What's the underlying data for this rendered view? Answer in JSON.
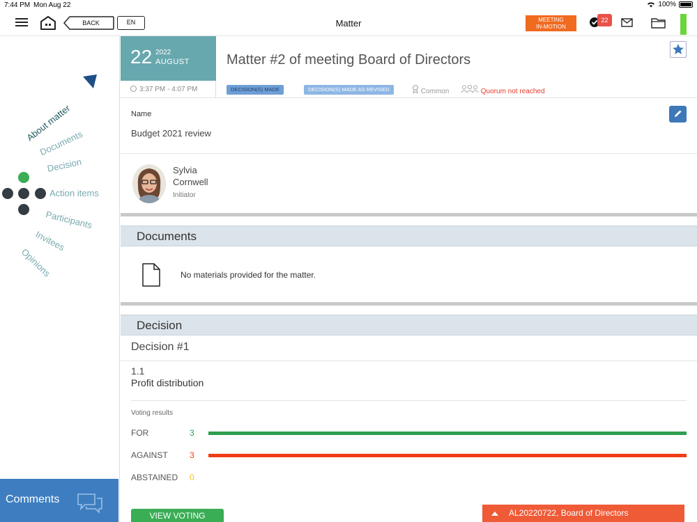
{
  "status_bar": {
    "time": "7:44 PM",
    "date": "Mon Aug 22",
    "battery": "100%"
  },
  "navbar": {
    "title": "Matter",
    "back_label": "BACK",
    "language": "EN",
    "meeting_badge_line1": "MEETING",
    "meeting_badge_line2": "IN-MOTION",
    "tasks_count": "22",
    "accent_color": "#f06a1f"
  },
  "sidebar": {
    "wheel_items": [
      "About matter",
      "Documents",
      "Decision",
      "Action items",
      "Participants",
      "Invitees",
      "Opinions"
    ],
    "comments_label": "Comments"
  },
  "matter": {
    "day": "22",
    "year": "2022",
    "month": "AUGUST",
    "time_range": "3:37 PM - 4:07 PM",
    "title": "Matter #2 of meeting Board of Directors",
    "tags": [
      "DECISION(S) MADE",
      "DECISION(S) MADE AS REVISED"
    ],
    "visibility": "Common",
    "quorum_status": "Quorum not reached",
    "name_label": "Name",
    "name_value": "Budget 2021 review",
    "initiator_name": "Sylvia Cornwell",
    "initiator_role": "Initiator"
  },
  "documents": {
    "heading": "Documents",
    "empty_text": "No materials provided for the matter."
  },
  "decision": {
    "heading": "Decision",
    "title": "Decision #1",
    "number": "1.1",
    "text": "Profit distribution",
    "voting_label": "Voting results",
    "votes": [
      {
        "label": "FOR",
        "count": "3",
        "share": 1.0,
        "color": "#2e9e4f"
      },
      {
        "label": "AGAINST",
        "count": "3",
        "share": 1.0,
        "color": "#f23c17"
      },
      {
        "label": "ABSTAINED",
        "count": "0",
        "share": 0.0,
        "color": "#f2c418"
      }
    ],
    "view_button": "VIEW VOTING RESULTS"
  },
  "bottom_bar": {
    "label": "AL20220722, Board of Directors"
  }
}
